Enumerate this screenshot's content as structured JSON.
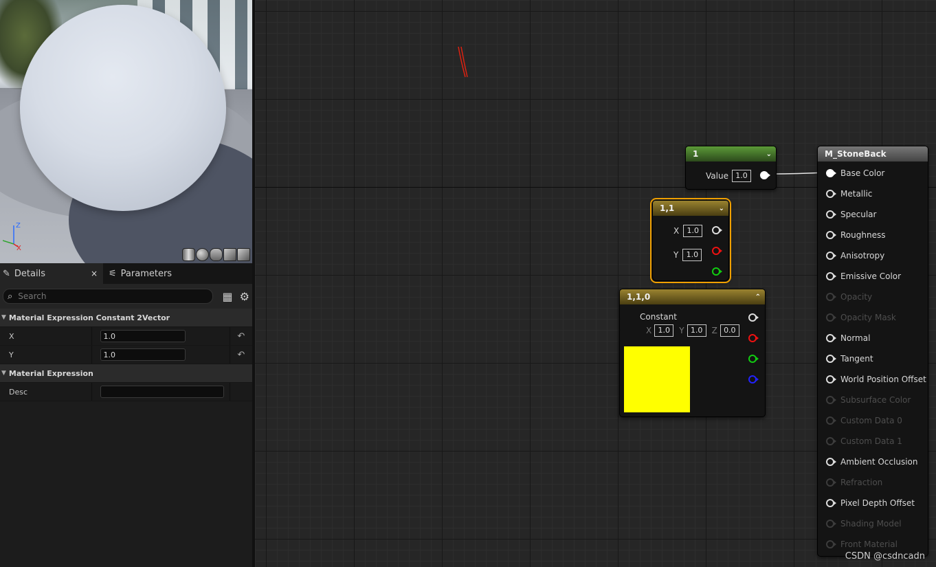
{
  "viewport": {
    "axis_labels": {
      "z": "Z",
      "x": "X"
    },
    "preview_shapes": [
      "cylinder-icon",
      "sphere-icon",
      "plane-icon",
      "cube-icon",
      "custom-mesh-icon"
    ]
  },
  "details_panel": {
    "tabs": [
      {
        "label": "Details",
        "icon": "pencil-icon",
        "close": "×"
      },
      {
        "label": "Parameters",
        "icon": "parameters-icon"
      }
    ],
    "search_placeholder": "Search",
    "categories": [
      {
        "title": "Material Expression Constant 2Vector",
        "properties": [
          {
            "name": "X",
            "value": "1.0"
          },
          {
            "name": "Y",
            "value": "1.0"
          }
        ]
      },
      {
        "title": "Material Expression",
        "properties": [
          {
            "name": "Desc",
            "value": ""
          }
        ]
      }
    ]
  },
  "graph": {
    "nodes": {
      "constant": {
        "title": "1",
        "value_label": "Value",
        "value": "1.0",
        "color": "#3f7a2a"
      },
      "constant2": {
        "title": "1,1",
        "x_label": "X",
        "x": "1.0",
        "y_label": "Y",
        "y": "1.0",
        "color": "#7d6a20",
        "selected_outline": "#f0a000"
      },
      "constant3": {
        "title": "1,1,0",
        "output_label": "Constant",
        "x_label": "X",
        "x": "1.0",
        "y_label": "Y",
        "y": "1.0",
        "z_label": "Z",
        "z": "0.0",
        "swatch_color": "#ffff00",
        "color": "#7d6a20"
      },
      "material_result": {
        "title": "M_StoneBack",
        "inputs": [
          {
            "label": "Base Color",
            "enabled": true,
            "connected": true
          },
          {
            "label": "Metallic",
            "enabled": true
          },
          {
            "label": "Specular",
            "enabled": true
          },
          {
            "label": "Roughness",
            "enabled": true
          },
          {
            "label": "Anisotropy",
            "enabled": true
          },
          {
            "label": "Emissive Color",
            "enabled": true
          },
          {
            "label": "Opacity",
            "enabled": false
          },
          {
            "label": "Opacity Mask",
            "enabled": false
          },
          {
            "label": "Normal",
            "enabled": true
          },
          {
            "label": "Tangent",
            "enabled": true
          },
          {
            "label": "World Position Offset",
            "enabled": true
          },
          {
            "label": "Subsurface Color",
            "enabled": false
          },
          {
            "label": "Custom Data 0",
            "enabled": false
          },
          {
            "label": "Custom Data 1",
            "enabled": false
          },
          {
            "label": "Ambient Occlusion",
            "enabled": true
          },
          {
            "label": "Refraction",
            "enabled": false
          },
          {
            "label": "Pixel Depth Offset",
            "enabled": true
          },
          {
            "label": "Shading Model",
            "enabled": false
          },
          {
            "label": "Front Material",
            "enabled": false
          }
        ]
      }
    }
  },
  "watermark": "CSDN @csdncadn"
}
